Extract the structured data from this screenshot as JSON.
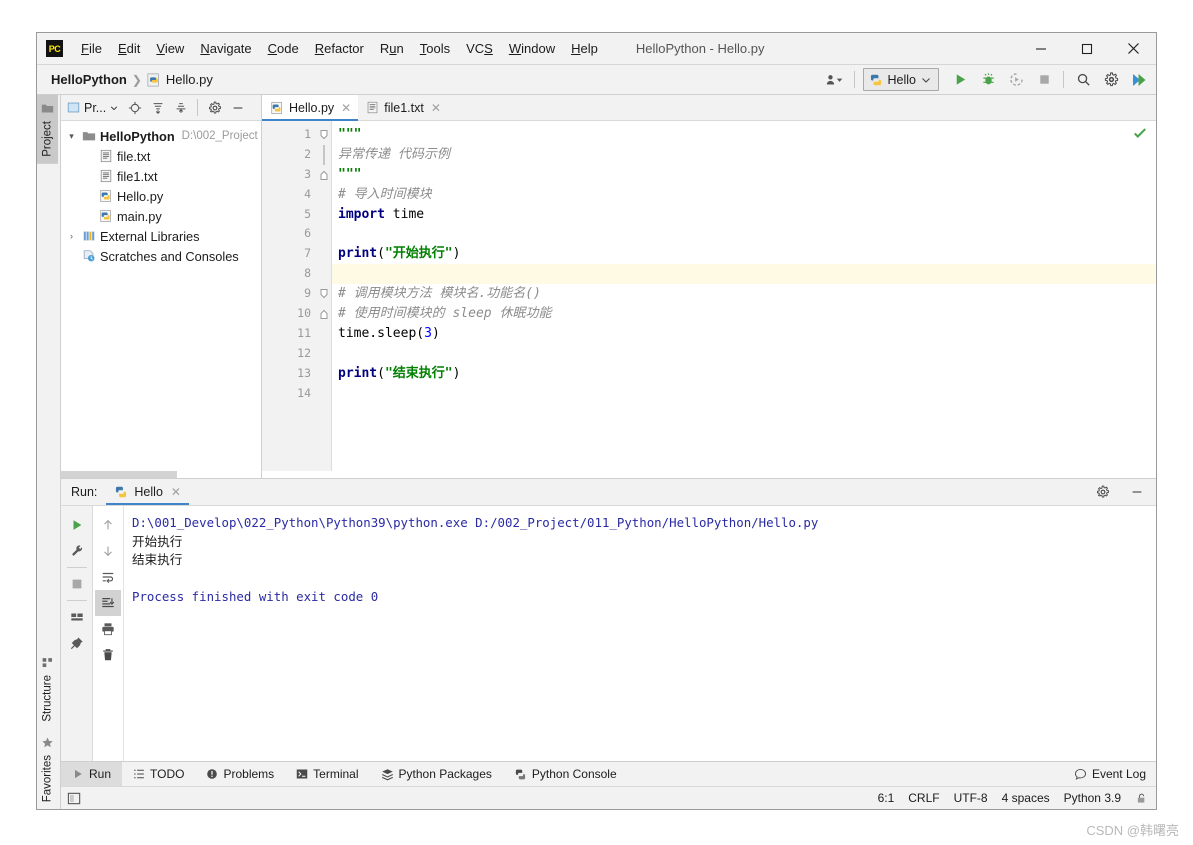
{
  "window": {
    "title": "HelloPython - Hello.py",
    "logo_text": "PC",
    "minimize": "—",
    "maximize": "▢",
    "close": "✕"
  },
  "menubar": {
    "items": [
      {
        "label": "File",
        "mnemonic": "F",
        "rest": "ile"
      },
      {
        "label": "Edit",
        "mnemonic": "E",
        "rest": "dit"
      },
      {
        "label": "View",
        "mnemonic": "V",
        "rest": "iew"
      },
      {
        "label": "Navigate",
        "mnemonic": "N",
        "rest": "avigate"
      },
      {
        "label": "Code",
        "mnemonic": "C",
        "rest": "ode"
      },
      {
        "label": "Refactor",
        "mnemonic": "R",
        "rest": "efactor"
      },
      {
        "label": "Run",
        "mnemonic": "R",
        "rest": "un"
      },
      {
        "label": "Tools",
        "mnemonic": "T",
        "rest": "ools"
      },
      {
        "label": "VCS",
        "mnemonic": "S",
        "rest": "VC"
      },
      {
        "label": "Window",
        "mnemonic": "W",
        "rest": "indow"
      },
      {
        "label": "Help",
        "mnemonic": "H",
        "rest": "elp"
      }
    ]
  },
  "navbar": {
    "project_crumb": "HelloPython",
    "separator": "❯",
    "file_crumb": "Hello.py",
    "run_config": "Hello",
    "icons": [
      "user-group-icon",
      "run-icon",
      "debug-icon",
      "coverage-icon",
      "stop-icon",
      "search-icon",
      "settings-icon",
      "updates-icon"
    ]
  },
  "left_strip": {
    "top": [
      {
        "label": "Project",
        "icon": "folder-icon",
        "selected": true
      }
    ],
    "bottom": [
      {
        "label": "Structure",
        "icon": "structure-icon",
        "selected": false
      },
      {
        "label": "Favorites",
        "icon": "star-icon",
        "selected": false
      }
    ]
  },
  "project_panel": {
    "title": "Pr...",
    "header_icons": [
      "target-icon",
      "collapse-all-icon",
      "expand-all-icon",
      "gear-icon",
      "minimize-icon"
    ],
    "tree": [
      {
        "indent": 0,
        "twisty": "▾",
        "icon": "folder-icon",
        "label": "HelloPython",
        "bold": true,
        "path": "D:\\002_Project"
      },
      {
        "indent": 1,
        "twisty": "",
        "icon": "text-file-icon",
        "label": "file.txt",
        "bold": false,
        "path": ""
      },
      {
        "indent": 1,
        "twisty": "",
        "icon": "text-file-icon",
        "label": "file1.txt",
        "bold": false,
        "path": ""
      },
      {
        "indent": 1,
        "twisty": "",
        "icon": "python-file-icon",
        "label": "Hello.py",
        "bold": false,
        "path": ""
      },
      {
        "indent": 1,
        "twisty": "",
        "icon": "python-file-icon",
        "label": "main.py",
        "bold": false,
        "path": ""
      },
      {
        "indent": 0,
        "twisty": "›",
        "icon": "libraries-icon",
        "label": "External Libraries",
        "bold": false,
        "path": ""
      },
      {
        "indent": 0,
        "twisty": "",
        "icon": "scratches-icon",
        "label": "Scratches and Consoles",
        "bold": false,
        "path": ""
      }
    ]
  },
  "editor": {
    "tabs": [
      {
        "label": "Hello.py",
        "icon": "python-file-icon",
        "active": true,
        "close": "✕"
      },
      {
        "label": "file1.txt",
        "icon": "text-file-icon",
        "active": false,
        "close": "✕"
      }
    ],
    "inspection_status": "ok-check-icon",
    "lines": [
      {
        "n": "1",
        "fold": "fold-start",
        "highlight": false,
        "tokens": [
          {
            "t": "\"\"\"",
            "c": "s"
          }
        ]
      },
      {
        "n": "2",
        "fold": "",
        "highlight": false,
        "tokens": [
          {
            "t": "异常传递 代码示例",
            "c": "cm"
          }
        ]
      },
      {
        "n": "3",
        "fold": "fold-end",
        "highlight": false,
        "tokens": [
          {
            "t": "\"\"\"",
            "c": "s"
          }
        ]
      },
      {
        "n": "4",
        "fold": "",
        "highlight": false,
        "tokens": [
          {
            "t": "# 导入时间模块",
            "c": "cm"
          }
        ]
      },
      {
        "n": "5",
        "fold": "",
        "highlight": false,
        "tokens": [
          {
            "t": "import",
            "c": "k"
          },
          {
            "t": " time",
            "c": "id"
          }
        ]
      },
      {
        "n": "6",
        "fold": "",
        "highlight": false,
        "tokens": []
      },
      {
        "n": "7",
        "fold": "",
        "highlight": false,
        "tokens": [
          {
            "t": "print",
            "c": "k"
          },
          {
            "t": "(",
            "c": "pl"
          },
          {
            "t": "\"开始执行\"",
            "c": "s"
          },
          {
            "t": ")",
            "c": "pl"
          }
        ]
      },
      {
        "n": "8",
        "fold": "",
        "highlight": true,
        "tokens": []
      },
      {
        "n": "9",
        "fold": "fold-start",
        "highlight": false,
        "tokens": [
          {
            "t": "# 调用模块方法 模块名.功能名()",
            "c": "cm"
          }
        ]
      },
      {
        "n": "10",
        "fold": "fold-end",
        "highlight": false,
        "tokens": [
          {
            "t": "# 使用时间模块的 sleep 休眠功能",
            "c": "cm"
          }
        ]
      },
      {
        "n": "11",
        "fold": "",
        "highlight": false,
        "tokens": [
          {
            "t": "time.sleep",
            "c": "id"
          },
          {
            "t": "(",
            "c": "pl"
          },
          {
            "t": "3",
            "c": "num"
          },
          {
            "t": ")",
            "c": "pl"
          }
        ]
      },
      {
        "n": "12",
        "fold": "",
        "highlight": false,
        "tokens": []
      },
      {
        "n": "13",
        "fold": "",
        "highlight": false,
        "tokens": [
          {
            "t": "print",
            "c": "k"
          },
          {
            "t": "(",
            "c": "pl"
          },
          {
            "t": "\"结束执行\"",
            "c": "s"
          },
          {
            "t": ")",
            "c": "pl"
          }
        ]
      },
      {
        "n": "14",
        "fold": "",
        "highlight": false,
        "tokens": []
      }
    ]
  },
  "run_panel": {
    "label": "Run:",
    "tab_label": "Hello",
    "tab_close": "✕",
    "header_icons": [
      "gear-icon",
      "minimize-icon"
    ],
    "tools_left": [
      "rerun-icon",
      "wrench-icon",
      "stop-icon",
      "layout-icon",
      "pin-icon"
    ],
    "tools_right": [
      "up-arrow-icon",
      "down-arrow-icon",
      "soft-wrap-icon",
      "scroll-to-end-icon",
      "print-icon",
      "trash-icon"
    ],
    "console": [
      {
        "text": "D:\\001_Develop\\022_Python\\Python39\\python.exe D:/002_Project/011_Python/HelloPython/Hello.py",
        "cls": "cpath"
      },
      {
        "text": "开始执行",
        "cls": "cout"
      },
      {
        "text": "结束执行",
        "cls": "cout"
      },
      {
        "text": "",
        "cls": "cout"
      },
      {
        "text": "Process finished with exit code 0",
        "cls": "cfin"
      }
    ]
  },
  "bottom_tabs": [
    {
      "label": "Run",
      "icon": "run-icon",
      "selected": true
    },
    {
      "label": "TODO",
      "icon": "todo-icon",
      "selected": false
    },
    {
      "label": "Problems",
      "icon": "problems-icon",
      "selected": false
    },
    {
      "label": "Terminal",
      "icon": "terminal-icon",
      "selected": false
    },
    {
      "label": "Python Packages",
      "icon": "packages-icon",
      "selected": false
    },
    {
      "label": "Python Console",
      "icon": "python-console-icon",
      "selected": false
    }
  ],
  "bottom_right": {
    "label": "Event Log",
    "icon": "event-log-icon"
  },
  "statusbar": {
    "left_icon": "toggle-sidebar-icon",
    "caret": "6:1",
    "line_separator": "CRLF",
    "encoding": "UTF-8",
    "indent": "4 spaces",
    "interpreter": "Python 3.9",
    "lock_icon": "lock-icon"
  },
  "watermark": "CSDN @韩曙亮",
  "colors": {
    "accent_blue": "#4083c9",
    "run_green": "#4aa24a",
    "string_green": "#008000",
    "keyword_navy": "#000080",
    "window_bg": "#f2f2f2"
  }
}
